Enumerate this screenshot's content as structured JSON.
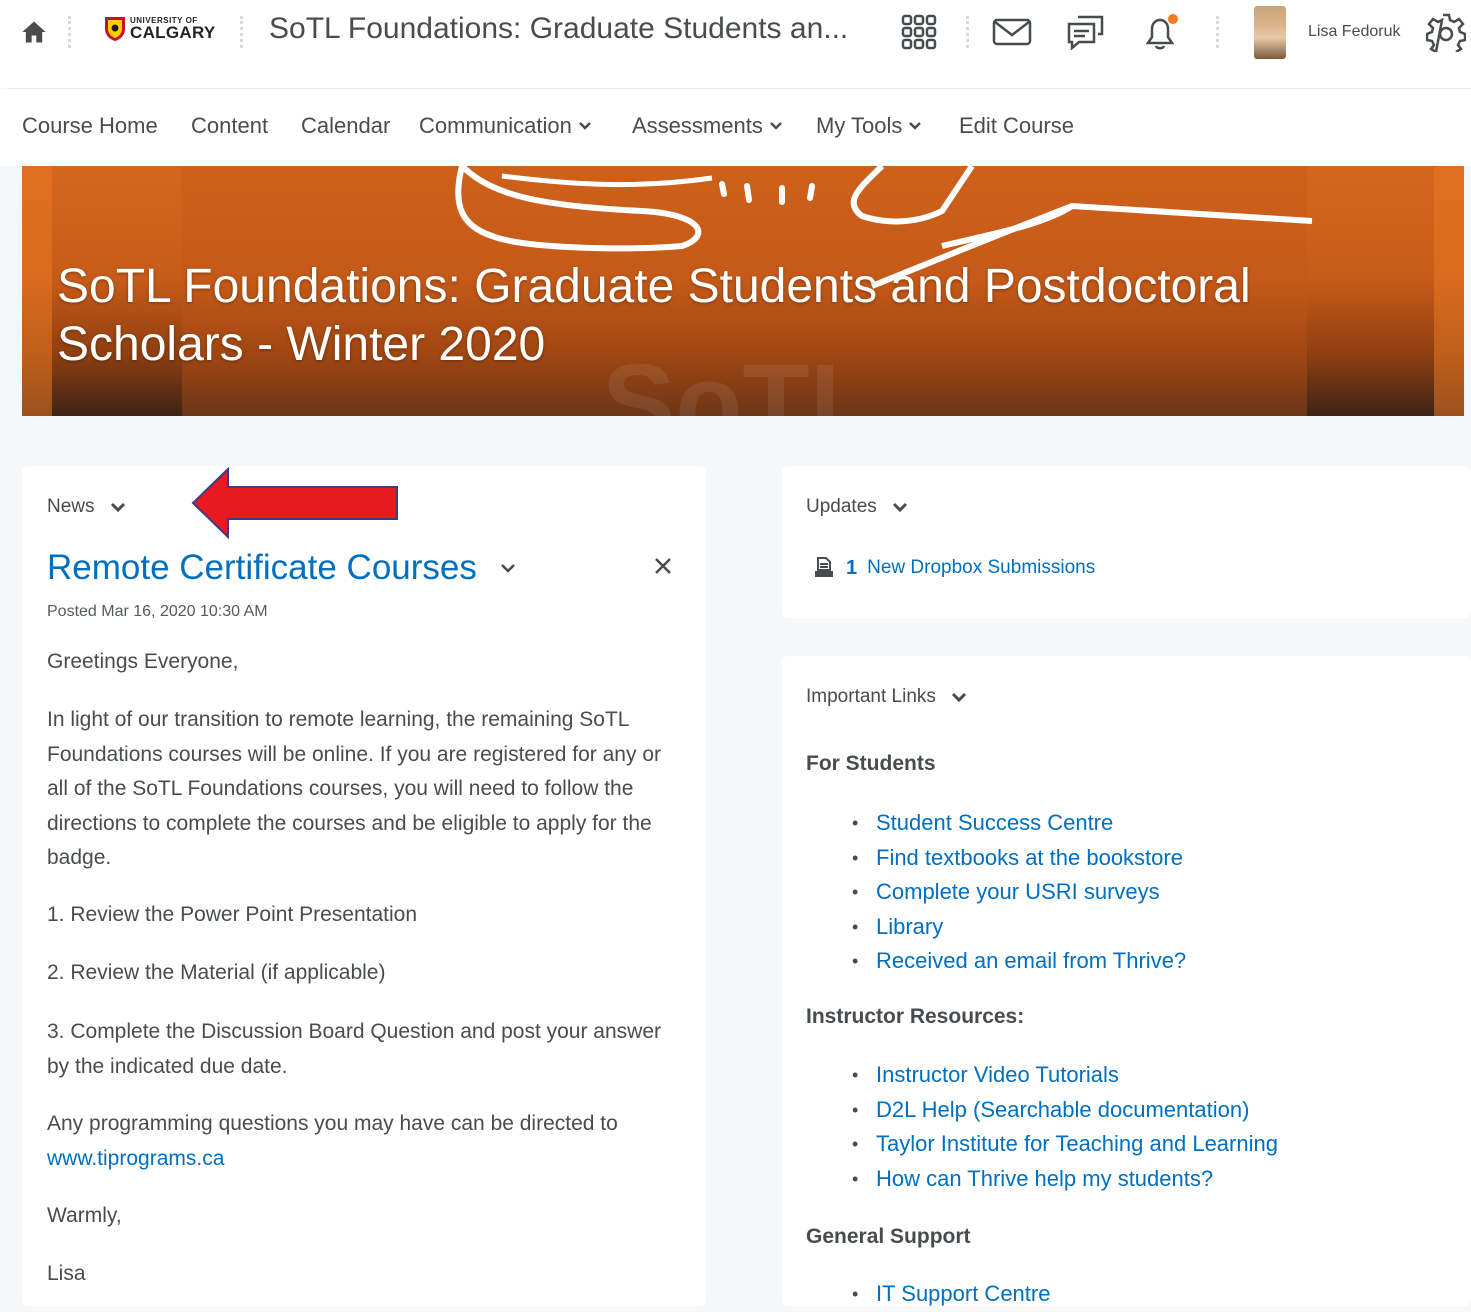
{
  "topbar": {
    "logo_line1": "UNIVERSITY OF",
    "logo_line2": "CALGARY",
    "course_title": "SoTL Foundations: Graduate Students an...",
    "user_name": "Lisa Fedoruk",
    "icons": [
      "home-icon",
      "waffle-grid-icon",
      "mail-icon",
      "discussion-icon",
      "bell-icon",
      "gear-icon"
    ],
    "notification_dot_color": "#f47b20"
  },
  "nav": {
    "items": [
      {
        "label": "Course Home",
        "dropdown": false
      },
      {
        "label": "Content",
        "dropdown": false
      },
      {
        "label": "Calendar",
        "dropdown": false
      },
      {
        "label": "Communication",
        "dropdown": true
      },
      {
        "label": "Assessments",
        "dropdown": true
      },
      {
        "label": "My Tools",
        "dropdown": true
      },
      {
        "label": "Edit Course",
        "dropdown": false
      }
    ]
  },
  "banner": {
    "title_line1": "SoTL Foundations: Graduate Students and Postdoctoral",
    "title_line2": "Scholars - Winter 2020",
    "color": "#d4671e"
  },
  "news": {
    "widget_title": "News",
    "item_title": "Remote Certificate Courses",
    "posted": "Posted Mar 16, 2020 10:30 AM",
    "greeting": "Greetings Everyone,",
    "paragraph": "In light of our transition to remote learning, the remaining SoTL Foundations courses will be online. If you are registered for any or all of the SoTL Foundations courses, you will need to follow the directions to complete the courses and be eligible to apply for the badge.",
    "step1": "1. Review the Power Point Presentation",
    "step2": "2. Review the Material (if applicable)",
    "step3": "3. Complete the Discussion Board Question and post your answer by the indicated due date.",
    "questions_prefix": "Any programming questions you may have can be directed to",
    "questions_link": "www.tiprograms.ca",
    "signoff": "Warmly,",
    "signature": "Lisa"
  },
  "updates": {
    "widget_title": "Updates",
    "count": "1",
    "label": "New Dropbox Submissions"
  },
  "important_links": {
    "widget_title": "Important Links",
    "sections": [
      {
        "heading": "For Students",
        "links": [
          "Student Success Centre",
          "Find textbooks at the bookstore",
          "Complete your USRI surveys",
          "Library",
          "Received an email from Thrive?"
        ]
      },
      {
        "heading": "Instructor Resources:",
        "links": [
          "Instructor Video Tutorials",
          "D2L Help (Searchable documentation)",
          "Taylor Institute for Teaching and Learning",
          "How can Thrive help my students?"
        ]
      },
      {
        "heading": "General Support",
        "links": [
          "IT Support Centre"
        ]
      }
    ]
  },
  "annotation": {
    "arrow_color": "#e8191f"
  }
}
